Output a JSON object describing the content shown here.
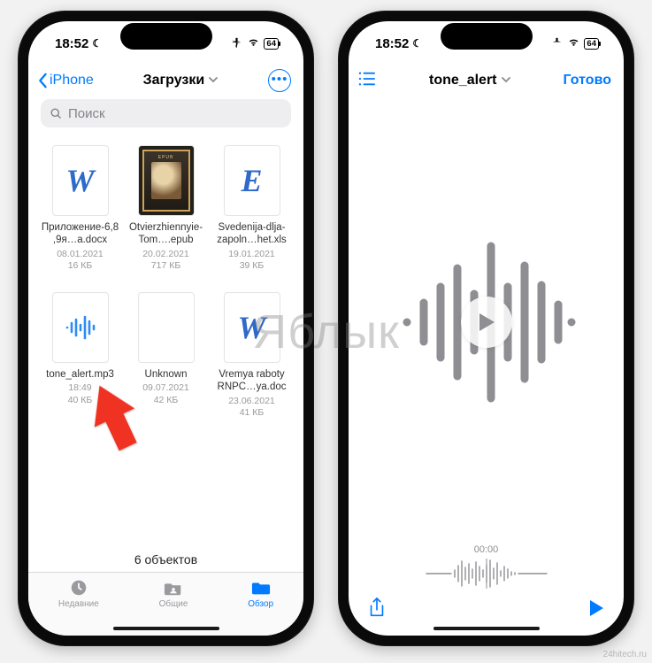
{
  "status": {
    "time": "18:52",
    "battery": "64"
  },
  "left": {
    "back_label": "iPhone",
    "title": "Загрузки",
    "search_placeholder": "Поиск",
    "files": [
      {
        "name": "Приложение-6,8,9я…a.docx",
        "date": "08.01.2021",
        "size": "16 КБ",
        "kind": "docx",
        "glyph": "W"
      },
      {
        "name": "Otvierzhiennyie-Tom….epub",
        "date": "20.02.2021",
        "size": "717 КБ",
        "kind": "epub",
        "glyph": ""
      },
      {
        "name": "Svedenija-dlja-zapoln…het.xls",
        "date": "19.01.2021",
        "size": "39 КБ",
        "kind": "xls",
        "glyph": "E"
      },
      {
        "name": "tone_alert.mp3",
        "date": "18:49",
        "size": "40 КБ",
        "kind": "audio",
        "glyph": ""
      },
      {
        "name": "Unknown",
        "date": "09.07.2021",
        "size": "42 КБ",
        "kind": "blank",
        "glyph": ""
      },
      {
        "name": "Vremya raboty RNPC…ya.doc",
        "date": "23.06.2021",
        "size": "41 КБ",
        "kind": "docx",
        "glyph": "W"
      }
    ],
    "count_label": "6 объектов",
    "tabs": {
      "recent": "Недавние",
      "shared": "Общие",
      "browse": "Обзор"
    }
  },
  "right": {
    "title": "tone_alert",
    "done_label": "Готово",
    "time_readout": "00:00"
  },
  "watermark": "Яблык",
  "site_credit": "24hitech.ru"
}
